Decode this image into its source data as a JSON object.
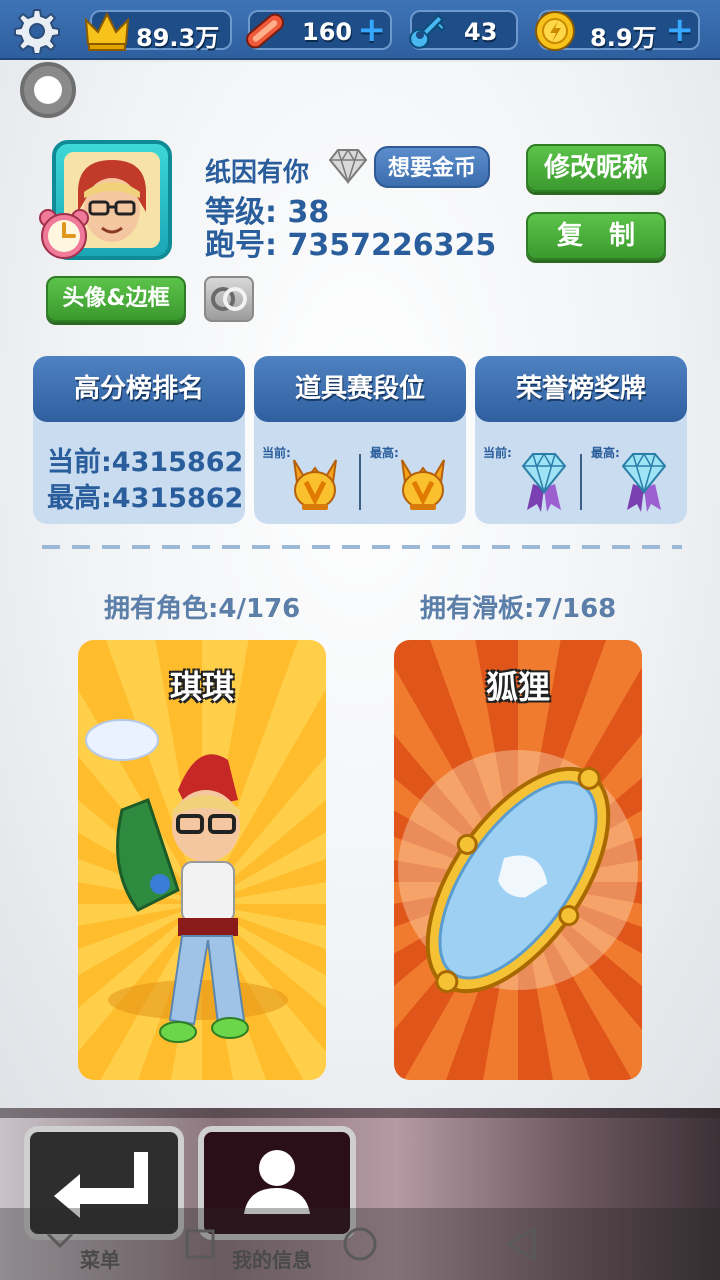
{
  "topbar": {
    "crowns": "89.3万",
    "boards": "160",
    "keys": "43",
    "coins": "8.9万",
    "plus": "+"
  },
  "profile": {
    "nickname": "纸因有你",
    "level_label": "等级:",
    "level": "38",
    "id_label": "跑号:",
    "id": "7357226325",
    "want_coins": "想要金币",
    "modify_nickname": "修改昵称",
    "copy": "复制",
    "avatar_frame": "头像&边框"
  },
  "cards": {
    "highscore": {
      "title": "高分榜排名",
      "current": "当前:4315862",
      "best": "最高:4315862"
    },
    "item_tier": {
      "title": "道具赛段位",
      "current_label": "当前:",
      "best_label": "最高:"
    },
    "honor": {
      "title": "荣誉榜奖牌",
      "current_label": "当前:",
      "best_label": "最高:"
    }
  },
  "ownership": {
    "characters": "拥有角色:4/176",
    "boards": "拥有滑板:7/168",
    "character_name": "琪琪",
    "board_name": "狐狸"
  },
  "bottom": {
    "menu": "菜单",
    "my_info": "我的信息"
  },
  "colors": {
    "topbar": "#3e74b8",
    "accent_blue": "#2a5d9c",
    "green_button": "#4caf3e",
    "character_tile": "#ffbd2e",
    "board_tile": "#e0561a"
  }
}
